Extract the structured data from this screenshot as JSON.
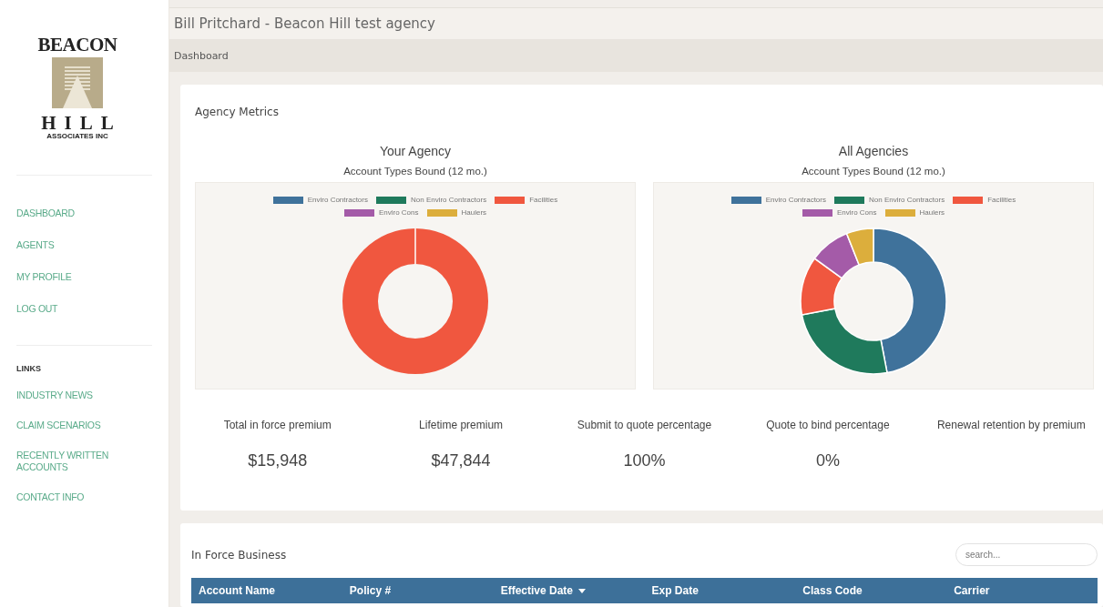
{
  "logo": {
    "top": "BEACON",
    "middle": "HILL",
    "bottom": "ASSOCIATES INC"
  },
  "sidebar": {
    "items": [
      {
        "label": "DASHBOARD"
      },
      {
        "label": "AGENTS"
      },
      {
        "label": "MY PROFILE"
      },
      {
        "label": "LOG OUT"
      }
    ],
    "links_heading": "LINKS",
    "links": [
      {
        "label": "INDUSTRY NEWS"
      },
      {
        "label": "CLAIM SCENARIOS"
      },
      {
        "label": "RECENTLY WRITTEN ACCOUNTS"
      },
      {
        "label": "CONTACT INFO"
      }
    ]
  },
  "header": {
    "title": "Bill Pritchard - Beacon Hill test agency",
    "breadcrumb": "Dashboard"
  },
  "metrics": {
    "title": "Agency Metrics",
    "charts": [
      {
        "title": "Your Agency",
        "subtitle": "Account Types Bound (12 mo.)",
        "kind": "single",
        "legend": [
          {
            "label": "Enviro Contractors",
            "color": "#3f729b"
          },
          {
            "label": "Non Enviro Contractors",
            "color": "#1f7a5c"
          },
          {
            "label": "Facilities",
            "color": "#f0573f"
          },
          {
            "label": "Enviro Cons",
            "color": "#a45ba8"
          },
          {
            "label": "Haulers",
            "color": "#dcae3c"
          }
        ]
      },
      {
        "title": "All Agencies",
        "subtitle": "Account Types Bound (12 mo.)",
        "kind": "mixed",
        "legend": [
          {
            "label": "Enviro Contractors",
            "color": "#3f729b"
          },
          {
            "label": "Non Enviro Contractors",
            "color": "#1f7a5c"
          },
          {
            "label": "Facilities",
            "color": "#f0573f"
          },
          {
            "label": "Enviro Cons",
            "color": "#a45ba8"
          },
          {
            "label": "Haulers",
            "color": "#dcae3c"
          }
        ]
      }
    ],
    "stats": [
      {
        "label": "Total in force premium",
        "value": "$15,948"
      },
      {
        "label": "Lifetime premium",
        "value": "$47,844"
      },
      {
        "label": "Submit to quote percentage",
        "value": "100%"
      },
      {
        "label": "Quote to bind percentage",
        "value": "0%"
      },
      {
        "label": "Renewal retention by premium"
      }
    ]
  },
  "business": {
    "title": "In Force Business",
    "search": {
      "placeholder": "search..."
    },
    "columns": [
      {
        "label": "Account Name",
        "sorted": false
      },
      {
        "label": "Policy #",
        "sorted": false
      },
      {
        "label": "Effective Date",
        "sorted": true
      },
      {
        "label": "Exp Date",
        "sorted": false
      },
      {
        "label": "Class Code",
        "sorted": false
      },
      {
        "label": "Carrier",
        "sorted": false
      }
    ]
  }
}
